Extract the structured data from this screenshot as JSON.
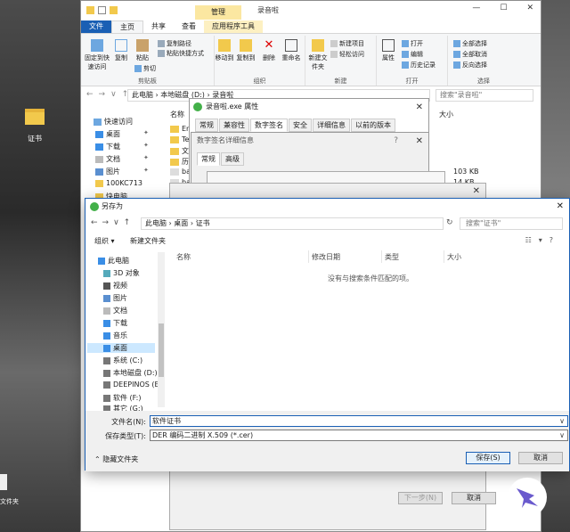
{
  "desktop": {
    "folder_label": "证书",
    "file_label": "文件夹"
  },
  "explorer": {
    "context_tab": "管理",
    "title": "录音啦",
    "tabs": [
      "文件",
      "主页",
      "共享",
      "查看",
      "应用程序工具"
    ],
    "ribbon": {
      "pin_label": "固定到快速访问",
      "copy_label": "复制",
      "paste_label": "粘贴",
      "copy_path": "复制路径",
      "paste_shortcut": "粘贴快捷方式",
      "cut": "剪切",
      "clipboard_group": "剪贴板",
      "move_to": "移动到",
      "copy_to": "复制到",
      "delete": "删除",
      "rename": "重命名",
      "organize_group": "组织",
      "new_folder": "新建文件夹",
      "new_item": "新建项目",
      "easy_access": "轻松访问",
      "new_group": "新建",
      "properties": "属性",
      "open": "打开",
      "edit": "编辑",
      "history": "历史记录",
      "open_group": "打开",
      "select_all": "全部选择",
      "select_none": "全部取消",
      "invert": "反向选择",
      "select_group": "选择"
    },
    "path": "此电脑 › 本地磁盘 (D:) › 录音啦",
    "search_placeholder": "搜索\"录音啦\"",
    "nav_items": [
      "快速访问",
      "桌面",
      "下载",
      "文档",
      "图片",
      "100KC713",
      "快电脑"
    ],
    "col_name": "名称",
    "col_size": "大小",
    "rows": [
      "Enc",
      "Ter",
      "文件",
      "历史",
      "ba",
      "ba"
    ],
    "sizes": [
      "103 KB",
      "14 KB"
    ]
  },
  "props_dialog": {
    "title": "录音啦.exe 属性",
    "tabs": [
      "常规",
      "兼容性",
      "数字签名",
      "安全",
      "详细信息",
      "以前的版本"
    ]
  },
  "sig_dialog": {
    "title": "数字签名详细信息",
    "tabs": [
      "常规",
      "高级"
    ]
  },
  "cert_dialog": {
    "prev_label": "证书",
    "next_button": "下一步(N)",
    "cancel_button": "取消"
  },
  "saveas": {
    "title": "另存为",
    "path": "此电脑 › 桌面 › 证书",
    "search_placeholder": "搜索\"证书\"",
    "organize": "组织 ▾",
    "new_folder": "新建文件夹",
    "nav_items": [
      "此电脑",
      "3D 对象",
      "视频",
      "图片",
      "文档",
      "下载",
      "音乐",
      "桌面",
      "系统 (C:)",
      "本地磁盘 (D:)",
      "DEEPINOS (E:)",
      "软件 (F:)",
      "其它 (G:)"
    ],
    "columns": [
      "名称",
      "修改日期",
      "类型",
      "大小"
    ],
    "empty_message": "没有与搜索条件匹配的项。",
    "filename_label": "文件名(N):",
    "filename_value": "软件证书",
    "filetype_label": "保存类型(T):",
    "filetype_value": "DER 编码二进制 X.509 (*.cer)",
    "hide_folders": "隐藏文件夹",
    "save_button": "保存(S)",
    "cancel_button": "取消"
  },
  "colors": {
    "accent": "#1a5fb4",
    "folder": "#f2c94c",
    "selection": "#cce8ff"
  }
}
